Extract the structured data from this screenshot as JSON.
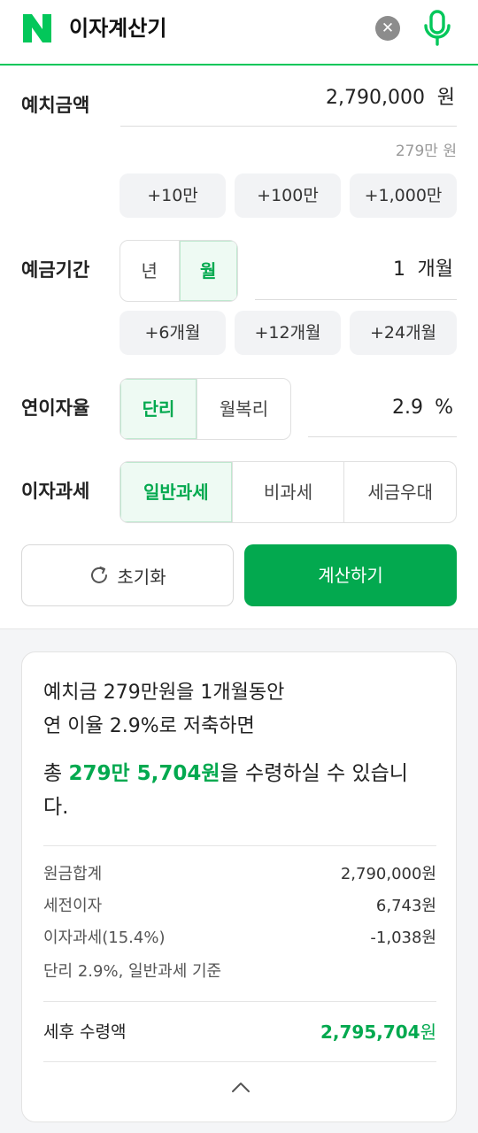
{
  "header": {
    "title": "이자계산기",
    "clear_symbol": "✕",
    "logo_icon": "naver-n-logo",
    "mic_icon": "mic-icon"
  },
  "deposit": {
    "label": "예치금액",
    "value": "2,790,000",
    "unit": "원",
    "hint": "279만 원",
    "chips": [
      "+10만",
      "+100만",
      "+1,000만"
    ]
  },
  "period": {
    "label": "예금기간",
    "options": [
      "년",
      "월"
    ],
    "selected": "월",
    "value": "1",
    "unit": "개월",
    "chips": [
      "+6개월",
      "+12개월",
      "+24개월"
    ]
  },
  "rate": {
    "label": "연이자율",
    "options": [
      "단리",
      "월복리"
    ],
    "selected": "단리",
    "value": "2.9",
    "unit": "%"
  },
  "tax": {
    "label": "이자과세",
    "options": [
      "일반과세",
      "비과세",
      "세금우대"
    ],
    "selected": "일반과세"
  },
  "actions": {
    "reset": "초기화",
    "calculate": "계산하기"
  },
  "result": {
    "line1": "예치금 279만원을 1개월동안",
    "line2": "연 이율 2.9%로 저축하면",
    "total_prefix": "총 ",
    "total_amount": "279만 5,704원",
    "total_suffix": "을 수령하실 수 있습니다.",
    "rows": [
      {
        "key": "원금합계",
        "value": "2,790,000원"
      },
      {
        "key": "세전이자",
        "value": "6,743원"
      },
      {
        "key": "이자과세(15.4%)",
        "value": "-1,038원"
      }
    ],
    "basis": "단리 2.9%, 일반과세 기준",
    "final_label": "세후 수령액",
    "final_value": "2,795,704",
    "final_unit": "원"
  },
  "colors": {
    "accent": "#03a94f",
    "brand": "#03c75a"
  }
}
